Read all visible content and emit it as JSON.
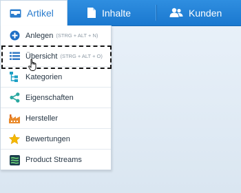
{
  "nav": {
    "tabs": [
      {
        "label": "Artikel",
        "icon": "inbox-icon",
        "active": true
      },
      {
        "label": "Inhalte",
        "icon": "document-icon",
        "active": false
      },
      {
        "label": "Kunden",
        "icon": "users-icon",
        "active": false
      }
    ]
  },
  "menu": {
    "items": [
      {
        "label": "Anlegen",
        "shortcut": "(STRG + ALT + N)",
        "icon": "plus-circle-icon"
      },
      {
        "label": "Übersicht",
        "shortcut": "(STRG + ALT + O)",
        "icon": "list-icon"
      },
      {
        "label": "Kategorien",
        "shortcut": "",
        "icon": "tree-icon"
      },
      {
        "label": "Eigenschaften",
        "shortcut": "",
        "icon": "share-icon"
      },
      {
        "label": "Hersteller",
        "shortcut": "",
        "icon": "factory-icon"
      },
      {
        "label": "Bewertungen",
        "shortcut": "",
        "icon": "star-icon"
      },
      {
        "label": "Product Streams",
        "shortcut": "",
        "icon": "streams-icon"
      }
    ]
  },
  "colors": {
    "nav_bg": "#1a78cf",
    "accent": "#2a7ccd",
    "page_bg": "#dde8f2"
  }
}
